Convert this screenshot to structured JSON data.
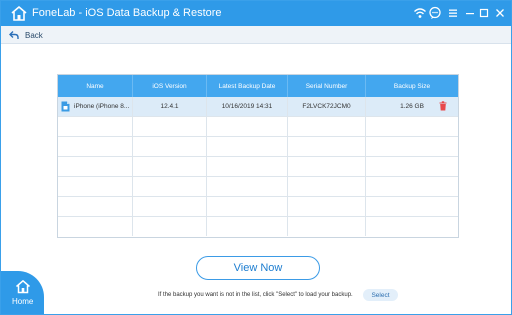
{
  "app": {
    "title": "FoneLab - iOS Data Backup & Restore"
  },
  "nav": {
    "back_label": "Back",
    "home_label": "Home"
  },
  "table": {
    "columns": [
      "Name",
      "iOS Version",
      "Latest Backup Date",
      "Serial Number",
      "Backup Size"
    ],
    "rows": [
      {
        "name": "iPhone (iPhone 8...",
        "ios_version": "12.4.1",
        "latest_backup_date": "10/16/2019 14:31",
        "serial_number": "F2LVCK72JCM0",
        "backup_size": "1.26  GB"
      }
    ]
  },
  "actions": {
    "view_now_label": "View Now",
    "hint_text": "If the backup you want is not in the list, click \"Select\" to load your backup.",
    "select_label": "Select"
  },
  "colors": {
    "accent": "#2f9ae8",
    "header": "#43a7ef",
    "selected_row": "#dcebf8",
    "delete": "#e8484b"
  }
}
